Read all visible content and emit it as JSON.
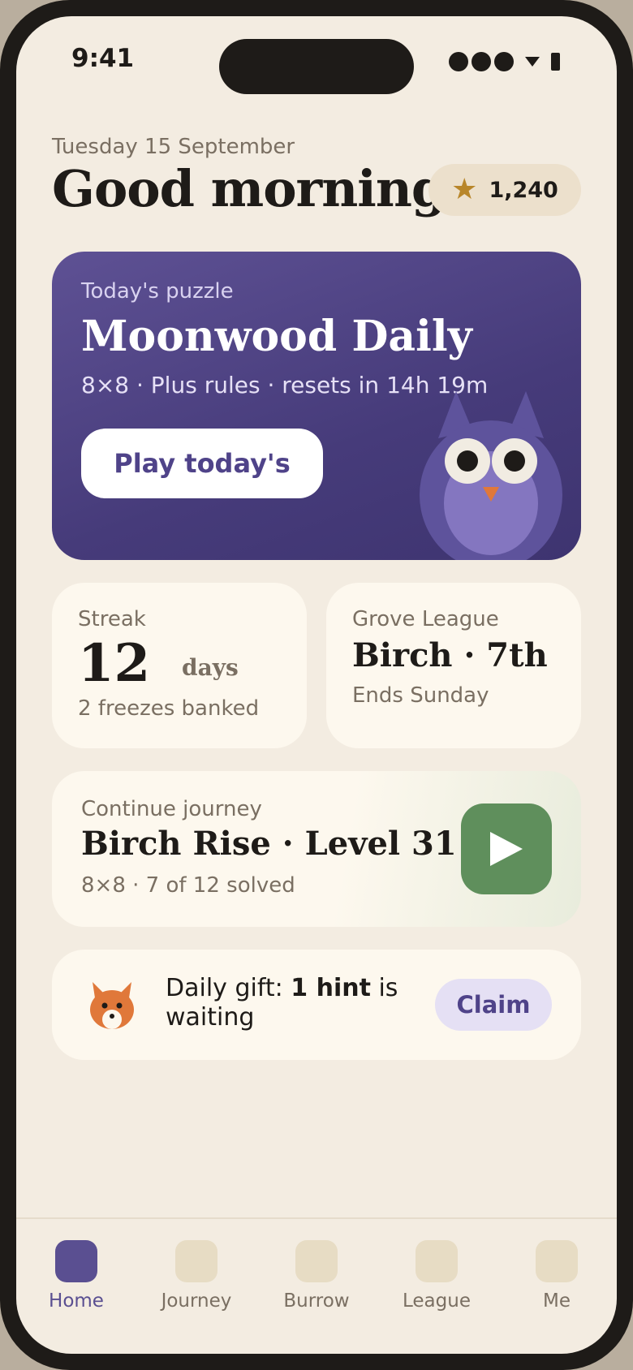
{
  "status_bar": {
    "time": "9:41"
  },
  "header": {
    "date": "Tuesday 15 September",
    "greeting": "Good morning",
    "points": "1,240",
    "points_icon": "star-icon"
  },
  "daily_puzzle": {
    "kicker": "Today's puzzle",
    "title": "Moonwood Daily",
    "subtitle": "8×8 · Plus rules · resets in 14h 19m",
    "button_label": "Play today's"
  },
  "streak": {
    "label": "Streak",
    "count": "12",
    "unit": "days",
    "freezes": "2 freezes banked"
  },
  "league": {
    "label": "Grove League",
    "standing": "Birch · 7th",
    "ends": "Ends Sunday"
  },
  "journey": {
    "label": "Continue journey",
    "title": "Birch Rise · Level 31",
    "progress": "8×8 · 7 of 12 solved"
  },
  "gift": {
    "prefix": "Daily gift: ",
    "bold": "1 hint",
    "suffix": " is waiting",
    "claim_label": "Claim"
  },
  "tabs": [
    {
      "label": "Home",
      "active": true
    },
    {
      "label": "Journey",
      "active": false
    },
    {
      "label": "Burrow",
      "active": false
    },
    {
      "label": "League",
      "active": false
    },
    {
      "label": "Me",
      "active": false
    }
  ],
  "colors": {
    "background": "#f3ece1",
    "accent": "#5a4f91",
    "hero": "#4f4389",
    "play_green": "#5f8f5c",
    "star": "#b8862a"
  }
}
